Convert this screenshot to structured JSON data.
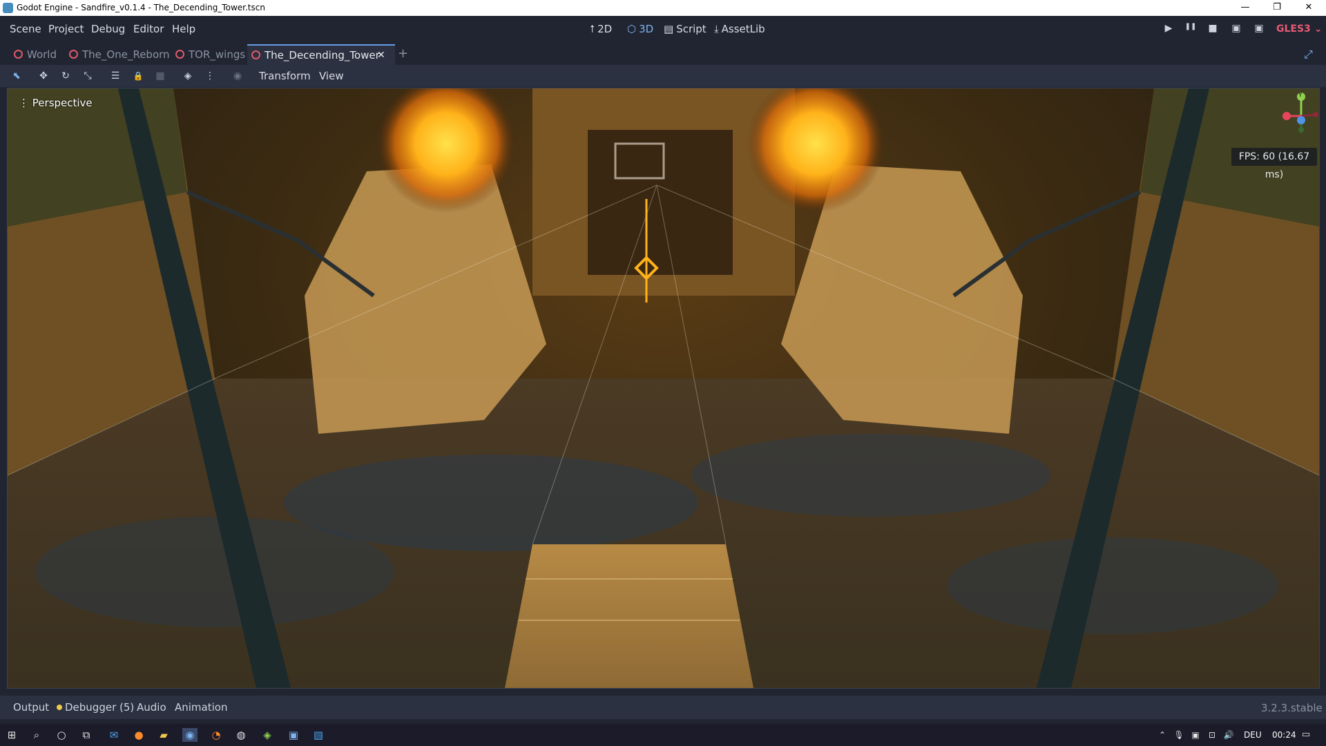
{
  "window": {
    "title": "Godot Engine - Sandfire_v0.1.4 - The_Decending_Tower.tscn",
    "minimize_glyph": "—",
    "restore_glyph": "❐",
    "close_glyph": "✕"
  },
  "menu": {
    "items": [
      "Scene",
      "Project",
      "Debug",
      "Editor",
      "Help"
    ]
  },
  "workspaces": {
    "items": [
      {
        "label": "2D",
        "icon": "⭡"
      },
      {
        "label": "3D",
        "icon": "⬡"
      },
      {
        "label": "Script",
        "icon": "▤"
      },
      {
        "label": "AssetLib",
        "icon": "⤓"
      }
    ],
    "active": "3D"
  },
  "play_controls": {
    "play": "▶",
    "pause": "❚❚",
    "stop": "■",
    "play_scene": "▣",
    "play_custom": "▣"
  },
  "renderer": "GLES3",
  "tabs": {
    "items": [
      "World",
      "The_One_Reborn",
      "TOR_wings",
      "The_Decending_Tower"
    ],
    "active": "The_Decending_Tower",
    "close_glyph": "✕",
    "add_glyph": "+",
    "fullscreen_glyph": "⤢"
  },
  "toolbar": {
    "menus": [
      "Transform",
      "View"
    ],
    "tools": {
      "select": "⬉",
      "move": "✥",
      "rotate": "↻",
      "scale": "⤡",
      "list": "☰",
      "lock": "🔒",
      "group": "▦",
      "local": "◈",
      "snap": "⋮",
      "camera": "◉"
    }
  },
  "viewport": {
    "mode_label": "Perspective",
    "menu_glyph": "⋮",
    "fps": "FPS: 60 (16.67 ms)",
    "gizmo": {
      "y": "Y",
      "x_color": "#e8455c",
      "y_color": "#8fd14f",
      "z_color": "#4f93e8"
    }
  },
  "bottom_panel": {
    "tabs": [
      "Output",
      "Debugger (5)",
      "Audio",
      "Animation"
    ],
    "version": "3.2.3.stable"
  },
  "taskbar": {
    "language": "DEU",
    "time": "00:24"
  }
}
